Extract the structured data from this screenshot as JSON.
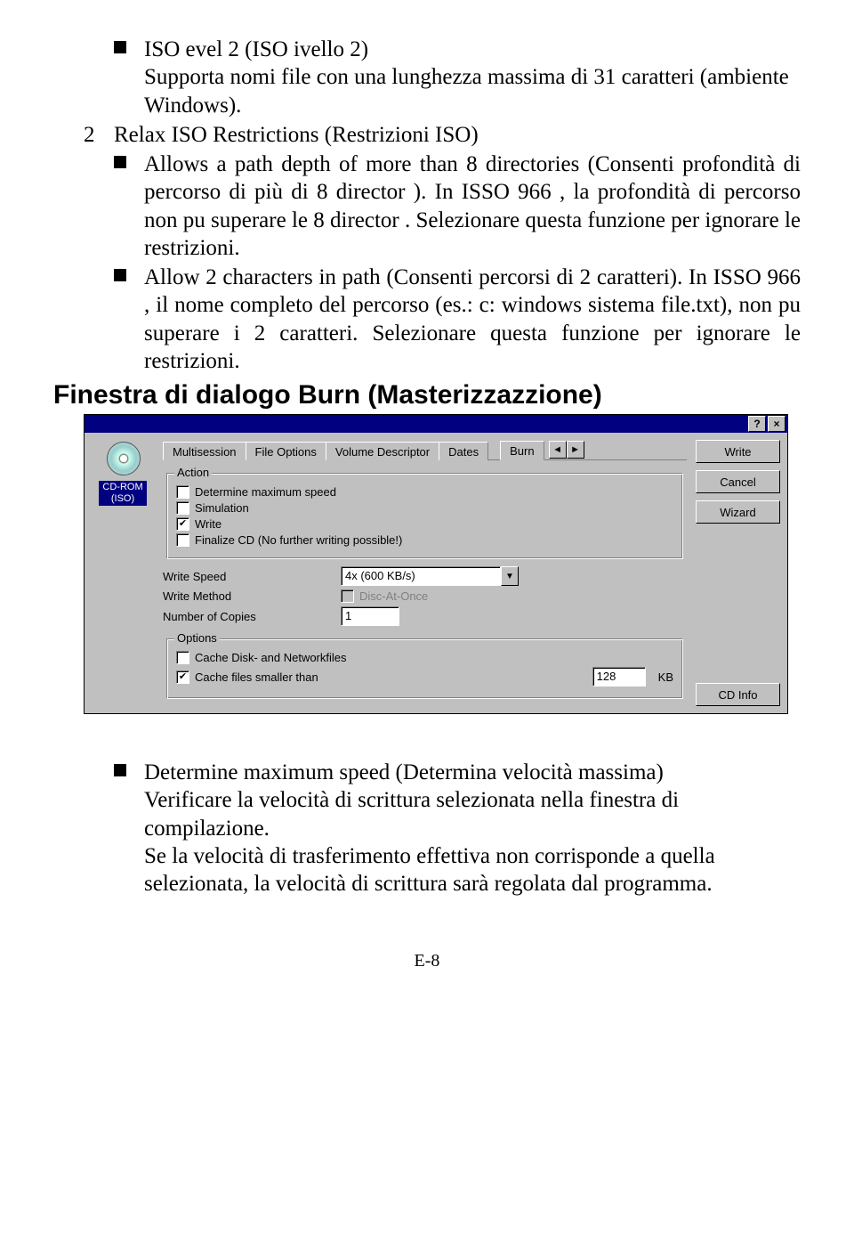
{
  "list1": {
    "item1_line1": "ISO   evel 2 (ISO   ivello 2)",
    "item1_line2": "Supporta nomi file con una lunghezza massima di 31  caratteri (ambiente Windows).",
    "num": "2",
    "numtext": "Relax ISO Restrictions (Restrizioni ISO)",
    "item2": "Allows a path depth of more than 8 directories (Consenti profondità di percorso di più di 8 director ). In ISSO 966 , la profondità di percorso non pu   superare le 8 director . Selezionare questa funzione per ignorare le restrizioni.",
    "item3": "Allow 2   characters in path (Consenti percorsi di 2   caratteri). In ISSO 966 , il nome completo del percorso (es.: c: windows sistema file.txt), non pu   superare i 2   caratteri. Selezionare questa funzione per ignorare le restrizioni."
  },
  "heading": "Finestra di dialogo Burn (Masterizzazzione)",
  "dialog": {
    "icon_label": "CD-ROM\n(ISO)",
    "tabs": [
      "Multisession",
      "File Options",
      "Volume Descriptor",
      "Dates",
      "Burn"
    ],
    "active_tab": "Burn",
    "group_action": "Action",
    "chk_speed": "Determine maximum speed",
    "chk_sim": "Simulation",
    "chk_write": "Write",
    "chk_finalize": "Finalize CD (No further writing possible!)",
    "lbl_write_speed": "Write Speed",
    "val_write_speed": "4x (600 KB/s)",
    "lbl_write_method": "Write Method",
    "val_write_method": "Disc-At-Once",
    "lbl_copies": "Number of Copies",
    "val_copies": "1",
    "group_options": "Options",
    "chk_cache_disk": "Cache Disk- and Networkfiles",
    "chk_cache_small": "Cache files smaller than",
    "val_cache_kb": "128",
    "lbl_kb": "KB",
    "btn_write": "Write",
    "btn_cancel": "Cancel",
    "btn_wizard": "Wizard",
    "btn_cdinfo": "CD Info",
    "help": "?",
    "close": "×"
  },
  "after": {
    "p1": "Determine maximum speed (Determina velocità massima)",
    "p2": "Verificare la velocità di scrittura selezionata nella finestra di compilazione.",
    "p3": "Se la velocità di trasferimento effettiva non corrisponde a quella selezionata, la velocità di scrittura sarà regolata dal programma."
  },
  "footer": "E-8"
}
